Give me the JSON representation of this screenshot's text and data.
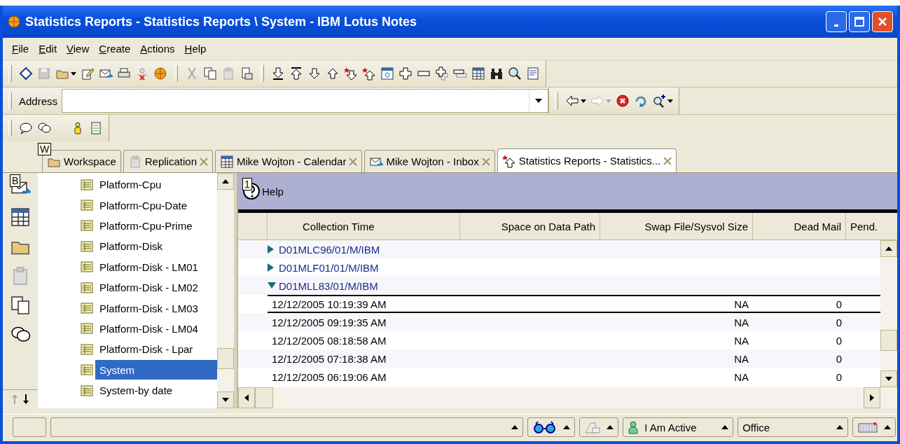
{
  "window": {
    "title": "Statistics Reports - Statistics Reports \\ System - IBM Lotus Notes"
  },
  "menu": [
    {
      "label": "File"
    },
    {
      "label": "Edit"
    },
    {
      "label": "View"
    },
    {
      "label": "Create"
    },
    {
      "label": "Actions"
    },
    {
      "label": "Help"
    }
  ],
  "address": {
    "label": "Address"
  },
  "tabs": [
    {
      "label": "Workspace",
      "selected": false,
      "closable": false,
      "hint": "W"
    },
    {
      "label": "Replication",
      "selected": false,
      "closable": true
    },
    {
      "label": "Mike Wojton - Calendar",
      "selected": false,
      "closable": true
    },
    {
      "label": "Mike Wojton - Inbox",
      "selected": false,
      "closable": true
    },
    {
      "label": "Statistics Reports - Statistics...",
      "selected": true,
      "closable": true
    }
  ],
  "bookmarks": {
    "hint": "B"
  },
  "nav": {
    "items": [
      {
        "label": "Platform-Cpu",
        "selected": false
      },
      {
        "label": "Platform-Cpu-Date",
        "selected": false
      },
      {
        "label": "Platform-Cpu-Prime",
        "selected": false
      },
      {
        "label": "Platform-Disk",
        "selected": false
      },
      {
        "label": "Platform-Disk - LM01",
        "selected": false
      },
      {
        "label": "Platform-Disk - LM02",
        "selected": false
      },
      {
        "label": "Platform-Disk - LM03",
        "selected": false
      },
      {
        "label": "Platform-Disk - LM04",
        "selected": false
      },
      {
        "label": "Platform-Disk - Lpar",
        "selected": false
      },
      {
        "label": "System",
        "selected": true
      },
      {
        "label": "System-by date",
        "selected": false
      }
    ]
  },
  "action_bar": {
    "hint": "1",
    "label": "Help"
  },
  "table": {
    "columns": [
      "Collection Time",
      "Space on Data Path",
      "Swap File/Sysvol Size",
      "Dead Mail",
      "Pend."
    ],
    "rows": [
      {
        "label": "D01MLC96/01/M/IBM",
        "expanded": false,
        "children": []
      },
      {
        "label": "D01MLF01/01/M/IBM",
        "expanded": false,
        "children": []
      },
      {
        "label": "D01MLL83/01/M/IBM",
        "expanded": true,
        "children": [
          {
            "time": "12/12/2005 10:19:39 AM",
            "swap": "NA",
            "dead": "0",
            "selected": true
          },
          {
            "time": "12/12/2005 09:19:35 AM",
            "swap": "NA",
            "dead": "0",
            "selected": false
          },
          {
            "time": "12/12/2005 08:18:58 AM",
            "swap": "NA",
            "dead": "0",
            "selected": false
          },
          {
            "time": "12/12/2005 07:18:38 AM",
            "swap": "NA",
            "dead": "0",
            "selected": false
          },
          {
            "time": "12/12/2005 06:19:06 AM",
            "swap": "NA",
            "dead": "0",
            "selected": false
          }
        ]
      }
    ]
  },
  "status_bar": {
    "status": "I Am Active",
    "location": "Office"
  }
}
